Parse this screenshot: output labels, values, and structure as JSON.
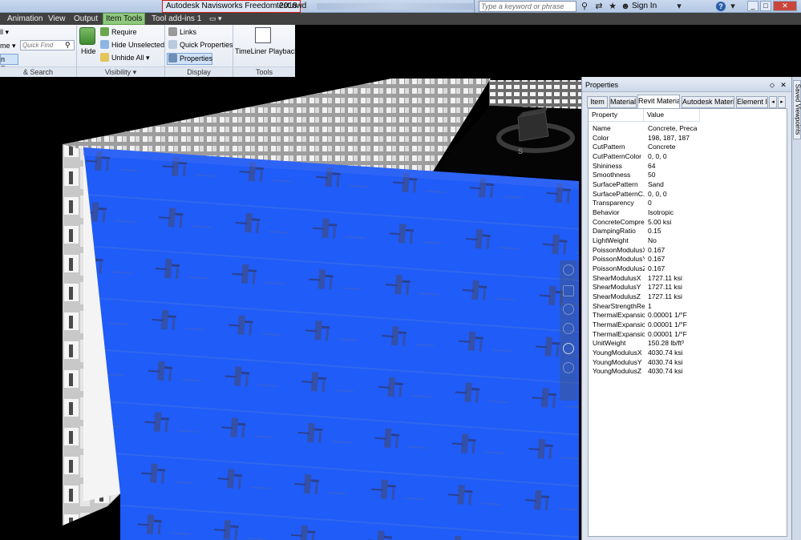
{
  "titlebar": {
    "app_title": "Autodesk Navisworks Freedom 2018",
    "file_name": "test.nwd",
    "search_placeholder": "Type a keyword or phrase",
    "sign_in": "Sign In",
    "help": "?",
    "minimize": "_",
    "maximize": "□",
    "close": "✕"
  },
  "menu": {
    "tabs": [
      "Animation",
      "View",
      "Output",
      "Item Tools",
      "Tool add-ins 1"
    ],
    "active_tab": "Item Tools",
    "camera_dropdown": "▭ ▾"
  },
  "ribbon": {
    "select_search": {
      "all_label": "ll",
      "name_label": "me",
      "quick_find_placeholder": "Quick Find",
      "selection_tree": "n Tree",
      "footer": "& Search"
    },
    "visibility": {
      "hide": "Hide",
      "require": "Require",
      "hide_unselected": "Hide Unselected",
      "unhide_all": "Unhide All",
      "footer": "Visibility"
    },
    "display": {
      "links": "Links",
      "quick_properties": "Quick Properties",
      "properties": "Properties",
      "footer": "Display"
    },
    "tools": {
      "timeliner": "TimeLiner Playback",
      "footer": "Tools"
    }
  },
  "viewcube": {
    "compass_south": "S"
  },
  "properties": {
    "title": "Properties",
    "pin": "⬦",
    "close": "✕",
    "tabs": [
      "Item",
      "Material",
      "Revit Material",
      "Autodesk Material",
      "Element ID"
    ],
    "active_tab": "Revit Material",
    "columns": [
      "Property",
      "Value"
    ],
    "rows": [
      {
        "name": "Name",
        "value": "Concrete, Preca..."
      },
      {
        "name": "Color",
        "value": "198, 187, 187"
      },
      {
        "name": "CutPattern",
        "value": "Concrete"
      },
      {
        "name": "CutPatternColor",
        "value": "0, 0, 0"
      },
      {
        "name": "Shininess",
        "value": "64"
      },
      {
        "name": "Smoothness",
        "value": "50"
      },
      {
        "name": "SurfacePattern",
        "value": "Sand"
      },
      {
        "name": "SurfacePatternC...",
        "value": "0, 0, 0"
      },
      {
        "name": "Transparency",
        "value": "0"
      },
      {
        "name": "Behavior",
        "value": "Isotropic"
      },
      {
        "name": "ConcreteCompre...",
        "value": "5.00 ksi"
      },
      {
        "name": "DampingRatio",
        "value": "0.15"
      },
      {
        "name": "LightWeight",
        "value": "No"
      },
      {
        "name": "PoissonModulusX",
        "value": "0.167"
      },
      {
        "name": "PoissonModulusY",
        "value": "0.167"
      },
      {
        "name": "PoissonModulusZ",
        "value": "0.167"
      },
      {
        "name": "ShearModulusX",
        "value": "1727.11 ksi"
      },
      {
        "name": "ShearModulusY",
        "value": "1727.11 ksi"
      },
      {
        "name": "ShearModulusZ",
        "value": "1727.11 ksi"
      },
      {
        "name": "ShearStrengthRe...",
        "value": "1"
      },
      {
        "name": "ThermalExpansio...",
        "value": "0.00001 1/°F"
      },
      {
        "name": "ThermalExpansio...",
        "value": "0.00001 1/°F"
      },
      {
        "name": "ThermalExpansio...",
        "value": "0.00001 1/°F"
      },
      {
        "name": "UnitWeight",
        "value": "150.28 lb/ft³"
      },
      {
        "name": "YoungModulusX",
        "value": "4030.74 ksi"
      },
      {
        "name": "YoungModulusY",
        "value": "4030.74 ksi"
      },
      {
        "name": "YoungModulusZ",
        "value": "4030.74 ksi"
      }
    ]
  },
  "right_strip": {
    "saved_viewpoints": "Saved Viewpoints"
  },
  "colors": {
    "selection_blue": "#1f5cf8",
    "active_tab_green": "#8fc97e",
    "title_highlight": "#d21919"
  }
}
